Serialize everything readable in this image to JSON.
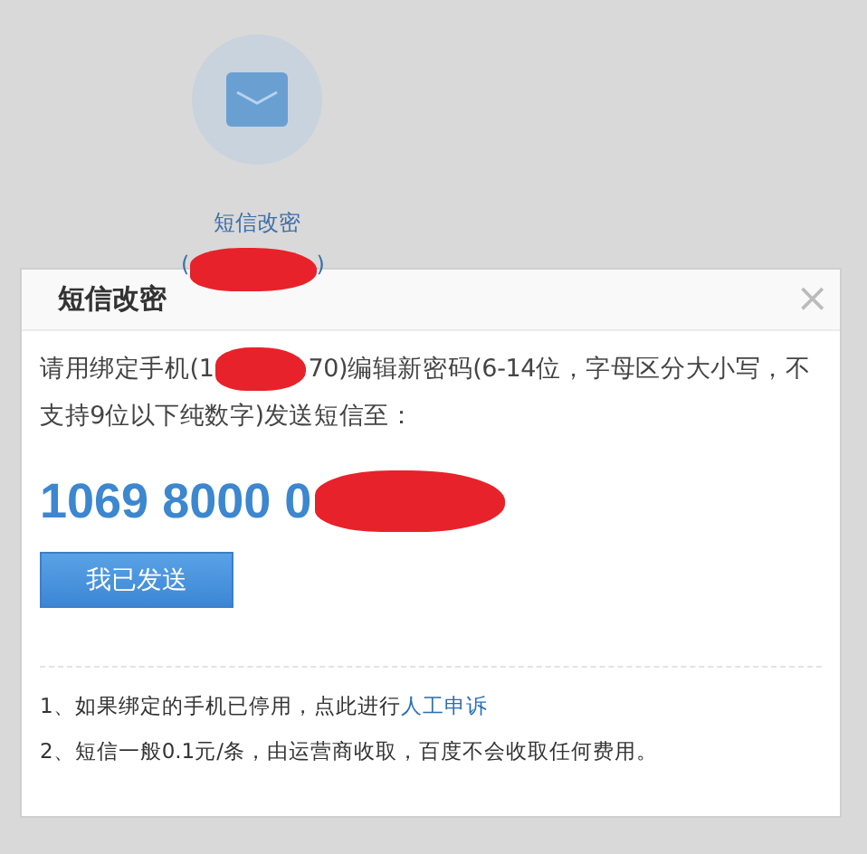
{
  "background_item": {
    "label": "短信改密",
    "open_paren": "(",
    "close_paren": ")"
  },
  "dialog": {
    "title": "短信改密",
    "close": "×",
    "instruction": {
      "before": "请用绑定手机(1",
      "after": "70)编辑新密码(6-14位，字母区分大小写，不",
      "line_2": "支持9位以下纯数字)发送短信至："
    },
    "number": "1069 8000 0",
    "button": "我已发送",
    "notes": [
      {
        "text": "1、如果绑定的手机已停用，点此进行",
        "link": "人工申诉"
      },
      {
        "text": "2、短信一般0.1元/条，由运营商收取，百度不会收取任何费用。"
      }
    ]
  }
}
